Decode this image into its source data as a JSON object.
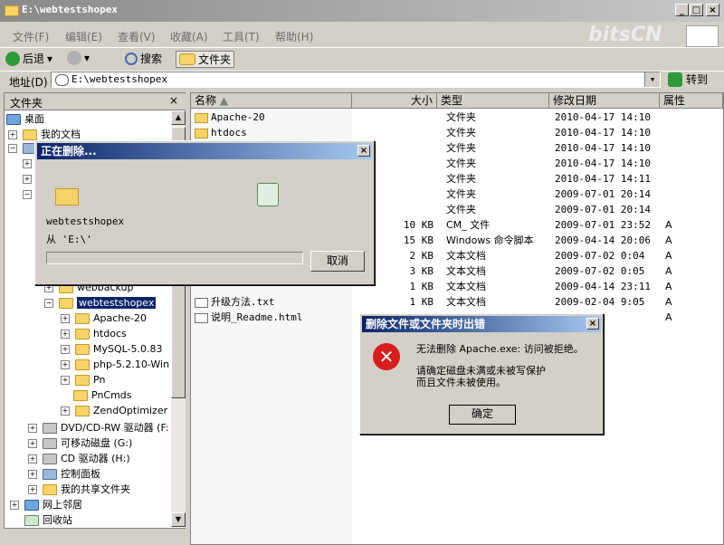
{
  "window": {
    "title": "E:\\webtestshopex",
    "brand_watermark": "bitsCN"
  },
  "menu": [
    "文件(F)",
    "编辑(E)",
    "查看(V)",
    "收藏(A)",
    "工具(T)",
    "帮助(H)"
  ],
  "toolbar": {
    "back": "后退",
    "search": "搜索",
    "folders": "文件夹"
  },
  "address": {
    "label": "地址(D)",
    "value": "E:\\webtestshopex",
    "go": "转到"
  },
  "folder_pane": {
    "title": "文件夹",
    "items": [
      {
        "label": "桌面"
      },
      {
        "label": "我的文档"
      },
      {
        "label": "webbackup"
      },
      {
        "label": "webtestshopex"
      },
      {
        "label": "Apache-20"
      },
      {
        "label": "htdocs"
      },
      {
        "label": "MySQL-5.0.83"
      },
      {
        "label": "php-5.2.10-Win"
      },
      {
        "label": "Pn"
      },
      {
        "label": "PnCmds"
      },
      {
        "label": "ZendOptimizer"
      },
      {
        "label": "DVD/CD-RW 驱动器 (F:"
      },
      {
        "label": "可移动磁盘 (G:)"
      },
      {
        "label": "CD 驱动器 (H:)"
      },
      {
        "label": "控制面板"
      },
      {
        "label": "我的共享文件夹"
      },
      {
        "label": "网上邻居"
      },
      {
        "label": "回收站"
      }
    ]
  },
  "list": {
    "columns": [
      "名称",
      "大小",
      "类型",
      "修改日期",
      "属性"
    ],
    "rows": [
      {
        "name": "Apache-20",
        "size": "",
        "type": "文件夹",
        "date": "2010-04-17 14:10",
        "attr": ""
      },
      {
        "name": "htdocs",
        "size": "",
        "type": "文件夹",
        "date": "2010-04-17 14:10",
        "attr": ""
      },
      {
        "name": "",
        "size": "",
        "type": "文件夹",
        "date": "2010-04-17 14:10",
        "attr": ""
      },
      {
        "name": "",
        "size": "",
        "type": "文件夹",
        "date": "2010-04-17 14:10",
        "attr": ""
      },
      {
        "name": "",
        "size": "",
        "type": "文件夹",
        "date": "2010-04-17 14:11",
        "attr": ""
      },
      {
        "name": "",
        "size": "",
        "type": "文件夹",
        "date": "2009-07-01 20:14",
        "attr": ""
      },
      {
        "name": "",
        "size": "",
        "type": "文件夹",
        "date": "2009-07-01 20:14",
        "attr": ""
      },
      {
        "name": "",
        "size": "10 KB",
        "type": "CM_ 文件",
        "date": "2009-07-01 23:52",
        "attr": "A"
      },
      {
        "name": "",
        "size": "15 KB",
        "type": "Windows 命令脚本",
        "date": "2009-04-14 20:06",
        "attr": "A"
      },
      {
        "name": "",
        "size": "2 KB",
        "type": "文本文档",
        "date": "2009-07-02 0:04",
        "attr": "A"
      },
      {
        "name": "",
        "size": "3 KB",
        "type": "文本文档",
        "date": "2009-07-02 0:05",
        "attr": "A"
      },
      {
        "name": "",
        "size": "1 KB",
        "type": "文本文档",
        "date": "2009-04-14 23:11",
        "attr": "A"
      },
      {
        "name": "升级方法.txt",
        "size": "1 KB",
        "type": "文本文档",
        "date": "2009-02-04 9:05",
        "attr": "A"
      },
      {
        "name": "说明_Readme.html",
        "size": "",
        "type": "",
        "date": "19:21",
        "attr": "A"
      }
    ]
  },
  "deleting_dialog": {
    "title": "正在删除...",
    "filename": "webtestshopex",
    "from": "从 'E:\\'",
    "progress": 0.0,
    "cancel": "取消"
  },
  "error_dialog": {
    "title": "删除文件或文件夹时出错",
    "line1": "无法删除 Apache.exe: 访问被拒绝。",
    "line2": "请确定磁盘未满或未被写保护",
    "line3": "而且文件未被使用。",
    "ok": "确定"
  }
}
